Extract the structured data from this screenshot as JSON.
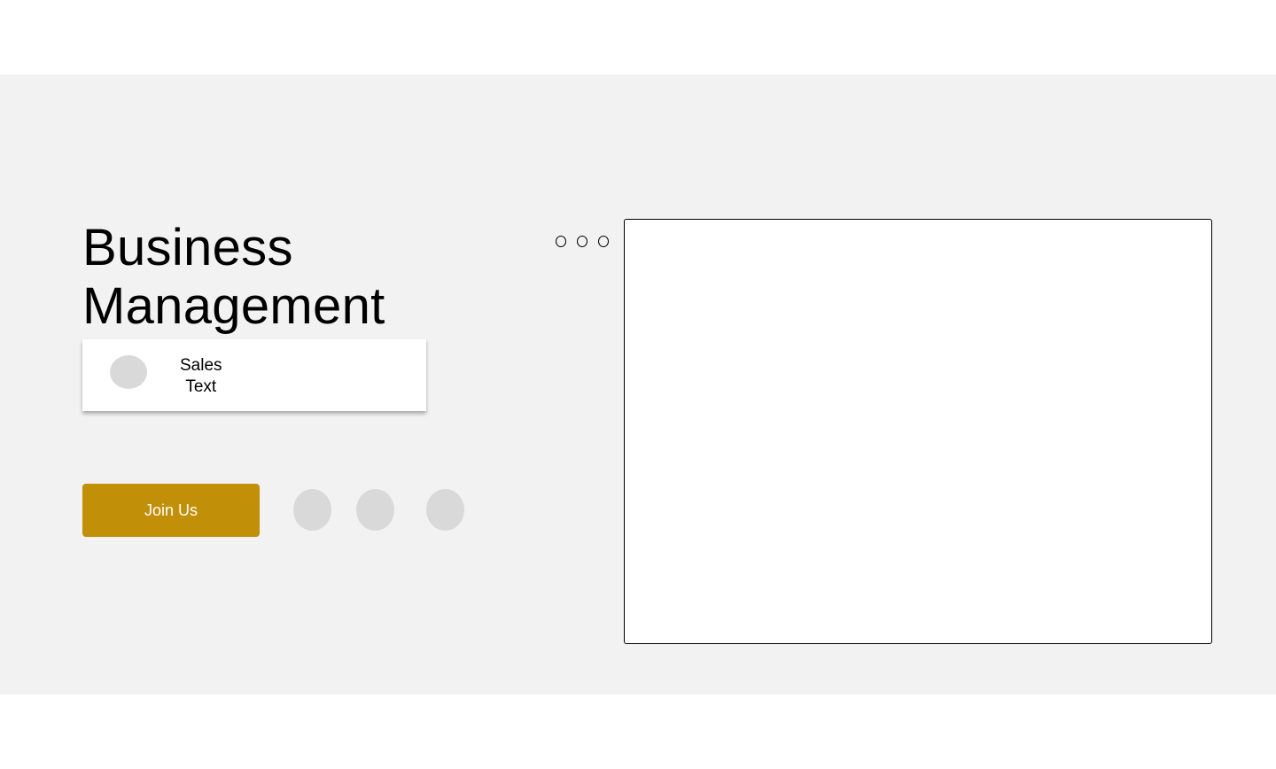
{
  "hero": {
    "title_line1": "Business",
    "title_line2": "Management",
    "card": {
      "line1": "Sales",
      "line2": "Text",
      "avatar_icon": "avatar-placeholder"
    },
    "join_label": "Join Us",
    "social_icons": [
      "social-icon-1",
      "social-icon-2",
      "social-icon-3"
    ],
    "accent_color": "#c28f09",
    "background_color": "#f2f2f2"
  },
  "preview": {
    "window_controls": [
      "window-control-1",
      "window-control-2",
      "window-control-3"
    ]
  }
}
